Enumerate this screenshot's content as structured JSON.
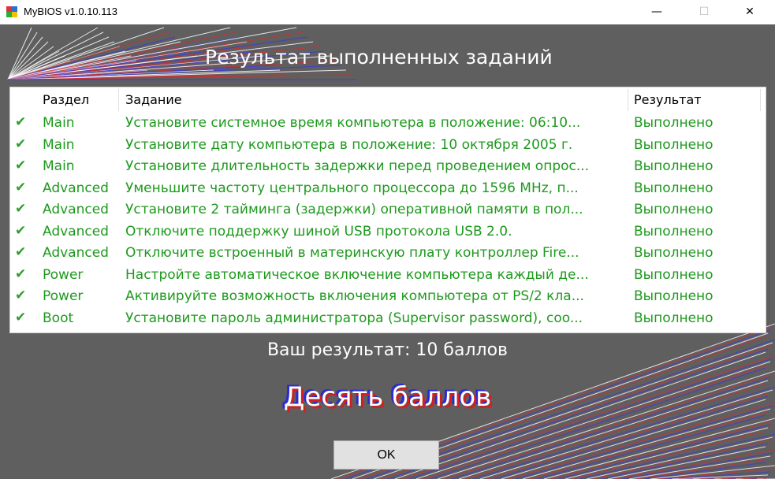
{
  "window": {
    "title": "MyBIOS v1.0.10.113",
    "minimize_glyph": "—",
    "maximize_glyph": "☐",
    "close_glyph": "✕"
  },
  "heading": "Результат выполненных заданий",
  "table": {
    "columns": [
      "Раздел",
      "Задание",
      "Результат"
    ],
    "rows": [
      {
        "section": "Main",
        "task": "Установите системное время компьютера в положение: 06:10...",
        "result": "Выполнено"
      },
      {
        "section": "Main",
        "task": "Установите дату компьютера в положение: 10 октября 2005 г.",
        "result": "Выполнено"
      },
      {
        "section": "Main",
        "task": "Установите длительность задержки перед проведением опрос...",
        "result": "Выполнено"
      },
      {
        "section": "Advanced",
        "task": "Уменьшите частоту центрального процессора до 1596 MHz, п...",
        "result": "Выполнено"
      },
      {
        "section": "Advanced",
        "task": "Установите 2 тайминга (задержки) оперативной памяти в пол...",
        "result": "Выполнено"
      },
      {
        "section": "Advanced",
        "task": "Отключите поддержку шиной USB протокола USB 2.0.",
        "result": "Выполнено"
      },
      {
        "section": "Advanced",
        "task": "Отключите встроенный в материнскую плату контроллер Fire...",
        "result": "Выполнено"
      },
      {
        "section": "Power",
        "task": "Настройте автоматическое включение компьютера каждый де...",
        "result": "Выполнено"
      },
      {
        "section": "Power",
        "task": "Активируйте возможность включения компьютера от PS/2 кла...",
        "result": "Выполнено"
      },
      {
        "section": "Boot",
        "task": "Установите пароль администратора (Supervisor password), coo...",
        "result": "Выполнено"
      }
    ],
    "check_glyph": "✔",
    "row_icon": "check-icon"
  },
  "score_line": "Ваш результат: 10 баллов",
  "score_words": "Десять баллов",
  "ok_label": "OK",
  "colors": {
    "background": "#5f5f5f",
    "row_text": "#1d9a1d",
    "line_red": "#d03030",
    "line_blue": "#3b3bd8",
    "line_white": "#ffffff"
  }
}
